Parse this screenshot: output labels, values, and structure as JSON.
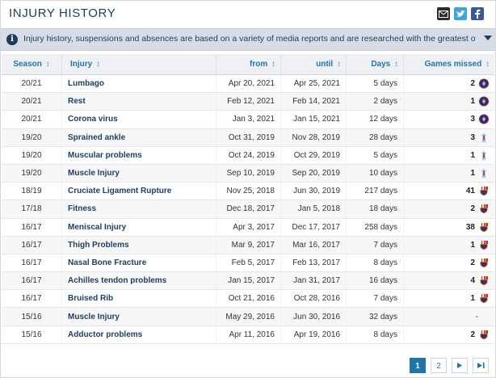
{
  "header": {
    "title": "INJURY HISTORY"
  },
  "share": {
    "mail": "✉",
    "twitter": "t",
    "facebook": "f"
  },
  "info": {
    "icon": "i",
    "text": "Injury history, suspensions and absences are based on a variety of media reports and are researched with the greatest of care. If you should n..."
  },
  "table": {
    "columns": [
      "Season",
      "Injury",
      "from",
      "until",
      "Days",
      "Games missed"
    ],
    "sort_glyph": "↕",
    "rows": [
      {
        "season": "20/21",
        "injury": "Lumbago",
        "from": "Apr 20, 2021",
        "until": "Apr 25, 2021",
        "days": "5 days",
        "games": "2",
        "club": "psg"
      },
      {
        "season": "20/21",
        "injury": "Rest",
        "from": "Feb 12, 2021",
        "until": "Feb 14, 2021",
        "days": "2 days",
        "games": "1",
        "club": "psg"
      },
      {
        "season": "20/21",
        "injury": "Corona virus",
        "from": "Jan 3, 2021",
        "until": "Jan 15, 2021",
        "days": "12 days",
        "games": "3",
        "club": "psg"
      },
      {
        "season": "19/20",
        "injury": "Sprained ankle",
        "from": "Oct 31, 2019",
        "until": "Nov 28, 2019",
        "days": "28 days",
        "games": "3",
        "club": "celta"
      },
      {
        "season": "19/20",
        "injury": "Muscular problems",
        "from": "Oct 24, 2019",
        "until": "Oct 29, 2019",
        "days": "5 days",
        "games": "1",
        "club": "celta"
      },
      {
        "season": "19/20",
        "injury": "Muscle Injury",
        "from": "Sep 10, 2019",
        "until": "Sep 20, 2019",
        "days": "10 days",
        "games": "1",
        "club": "celta"
      },
      {
        "season": "18/19",
        "injury": "Cruciate Ligament Rupture",
        "from": "Nov 25, 2018",
        "until": "Jun 30, 2019",
        "days": "217 days",
        "games": "41",
        "club": "fcb"
      },
      {
        "season": "17/18",
        "injury": "Fitness",
        "from": "Dec 18, 2017",
        "until": "Jan 5, 2018",
        "days": "18 days",
        "games": "2",
        "club": "fcb"
      },
      {
        "season": "16/17",
        "injury": "Meniscal Injury",
        "from": "Apr 3, 2017",
        "until": "Dec 17, 2017",
        "days": "258 days",
        "games": "38",
        "club": "fcb"
      },
      {
        "season": "16/17",
        "injury": "Thigh Problems",
        "from": "Mar 9, 2017",
        "until": "Mar 16, 2017",
        "days": "7 days",
        "games": "1",
        "club": "fcb"
      },
      {
        "season": "16/17",
        "injury": "Nasal Bone Fracture",
        "from": "Feb 5, 2017",
        "until": "Feb 13, 2017",
        "days": "8 days",
        "games": "2",
        "club": "fcb"
      },
      {
        "season": "16/17",
        "injury": "Achilles tendon problems",
        "from": "Jan 15, 2017",
        "until": "Jan 31, 2017",
        "days": "16 days",
        "games": "4",
        "club": "fcb"
      },
      {
        "season": "16/17",
        "injury": "Bruised Rib",
        "from": "Oct 21, 2016",
        "until": "Oct 28, 2016",
        "days": "7 days",
        "games": "1",
        "club": "fcb"
      },
      {
        "season": "15/16",
        "injury": "Muscle Injury",
        "from": "May 29, 2016",
        "until": "Jun 30, 2016",
        "days": "32 days",
        "games": "-",
        "club": ""
      },
      {
        "season": "15/16",
        "injury": "Adductor problems",
        "from": "Apr 11, 2016",
        "until": "Apr 19, 2016",
        "days": "8 days",
        "games": "2",
        "club": "fcb"
      }
    ]
  },
  "pagination": {
    "pages": [
      "1",
      "2"
    ],
    "next": "▸",
    "last": "▸|",
    "current": "1"
  },
  "colors": {
    "accent": "#1d75a9",
    "title": "#1d3d5d",
    "info_bg": "#d7dde6",
    "psg": "#0c3b7d",
    "celta": "#8ec3e6",
    "fcb_blue": "#004d98",
    "fcb_red": "#a50044"
  },
  "icons": {
    "mail": "envelope-icon",
    "twitter": "twitter-icon",
    "facebook": "facebook-icon",
    "info": "info-icon",
    "expand": "chevron-down-icon"
  }
}
